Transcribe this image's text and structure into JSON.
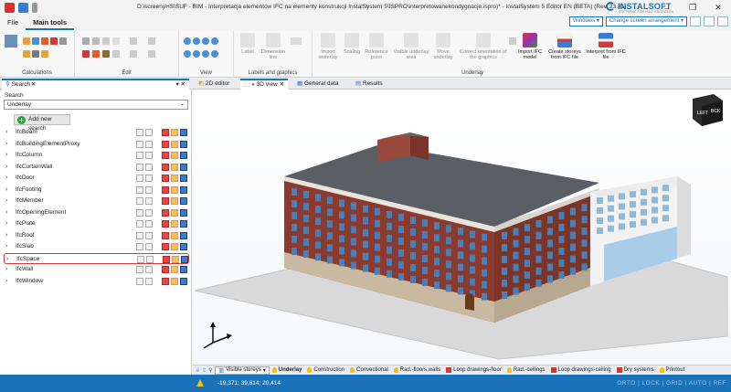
{
  "window": {
    "title": "D:\\screenyHS\\SUF - BIM - Interpretacja elementów IFC na elementy konstrukcji InstalSystem 5\\ISPRO\\interpretowanekondygnacje.ispro)* - InstalSystem 5 Editor EN (BETA) (Rev. 23.81)",
    "logo": "INSTALSOFT",
    "logo_sub": "SOFTWARE FOR HVAC ENGINEERS"
  },
  "menu": {
    "file": "File",
    "main_tools": "Main tools"
  },
  "topright": {
    "windows": "Windows ▾",
    "screen": "Change screen arrangement ▾"
  },
  "ribbon": {
    "groups": {
      "calculations": "Calculations",
      "edit": "Edit",
      "view": "View",
      "labels": "Labels and graphics",
      "underlay": "Underlay"
    },
    "buttons": {
      "label": "Label",
      "dimension": "Dimension line",
      "import_underlay": "Import underlay",
      "scaling": "Scaling",
      "reference": "Reference point",
      "visible_area": "Visible underlay area",
      "move_underlay": "Move underlay",
      "correct_orientation": "Correct orientation of the graphics",
      "import_ifc": "Import IFC model",
      "create_storeys": "Create storeys from IFC file",
      "interpret": "Interpret from IFC file"
    }
  },
  "tabs": {
    "search": "Search",
    "editor2d": "2D editor",
    "view3d": "3D view",
    "general": "General data",
    "results": "Results"
  },
  "search_panel": {
    "label": "Search",
    "select_value": "Underlay",
    "add_button": "Add new search",
    "items": [
      "IfcBeam",
      "IfcBuildingElementProxy",
      "IfcColumn",
      "IfcCurtainWall",
      "IfcDoor",
      "IfcFooting",
      "IfcMember",
      "IfcOpeningElement",
      "IfcPlate",
      "IfcRoof",
      "IfcSlab",
      "IfcSpace",
      "IfcWall",
      "IfcWindow"
    ],
    "selected_item": "IfcSpace"
  },
  "viewcube": {
    "left": "LEFT",
    "back": "BCK"
  },
  "bottom_bar": {
    "visible_storeys": "Visible storeys",
    "underlay": "Underlay",
    "construction": "Construction",
    "conventional": "Convectional",
    "rad_floors": "Rad.-floors,walls",
    "loop_floor": "Loop drawings-floor",
    "rad_ceilings": "Rad.-ceilings",
    "loop_ceiling": "Loop drawings-ceiling",
    "dry": "Dry systems",
    "printout": "Printout"
  },
  "status": {
    "coords": "-19,371; 39,614; 20,414",
    "right": "ORTO | LOCK | GRID | AUTO | REF"
  },
  "colors": {
    "accent": "#1a73b8",
    "selection": "#d23a3a"
  }
}
